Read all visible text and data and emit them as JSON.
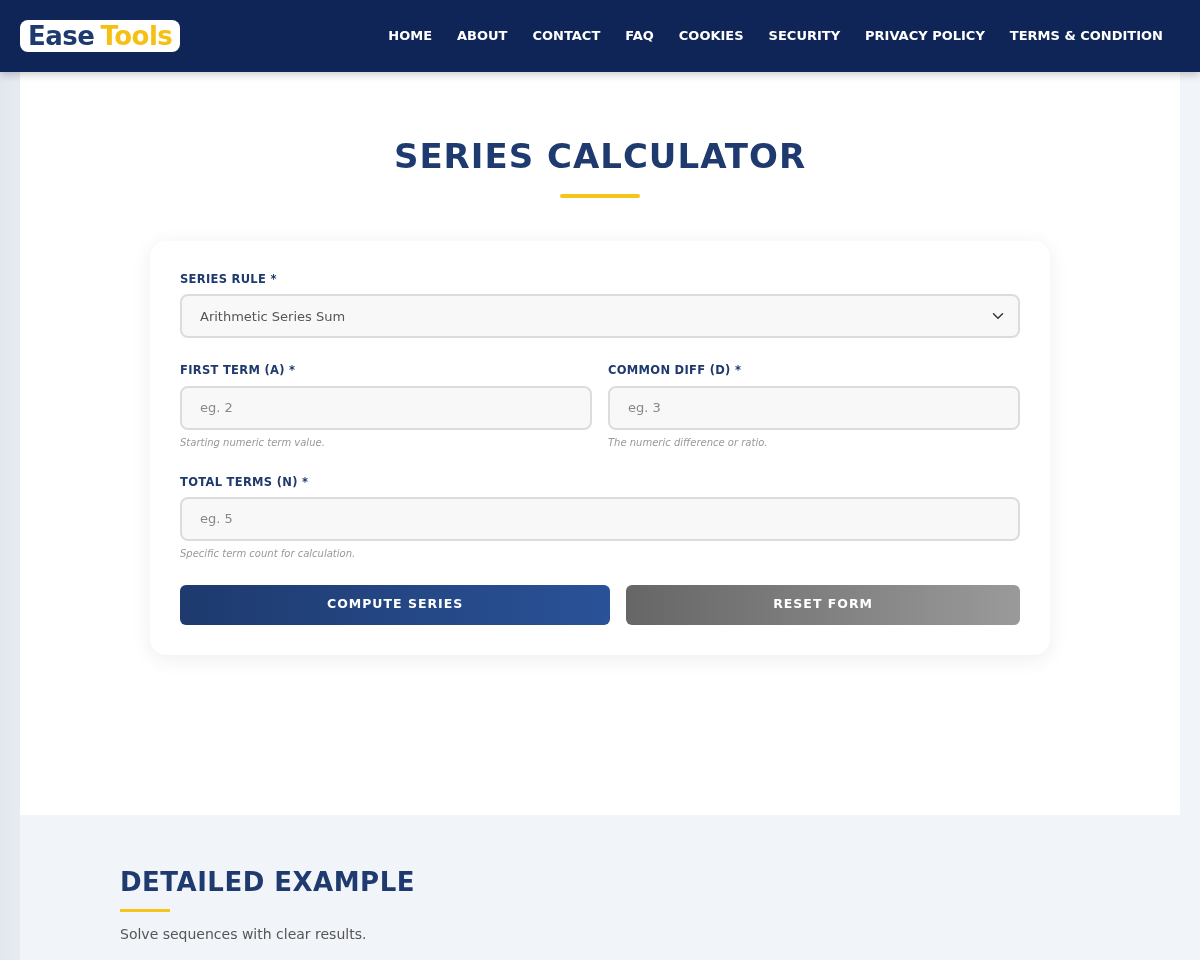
{
  "header": {
    "logo": {
      "part_1": "Ease",
      "part_2": "Tools"
    },
    "nav": [
      {
        "label": "HOME"
      },
      {
        "label": "ABOUT"
      },
      {
        "label": "CONTACT"
      },
      {
        "label": "FAQ"
      },
      {
        "label": "COOKIES"
      },
      {
        "label": "SECURITY"
      },
      {
        "label": "PRIVACY POLICY"
      },
      {
        "label": "TERMS & CONDITION"
      }
    ]
  },
  "calculator": {
    "title": "SERIES CALCULATOR",
    "rows": [
      [
        {
          "kind": "select",
          "label": "SERIES RULE *",
          "value": "Arithmetic Series Sum"
        }
      ],
      [
        {
          "kind": "input",
          "label": "FIRST TERM (A) *",
          "placeholder": "eg. 2",
          "hint": "Starting numeric term value."
        },
        {
          "kind": "input",
          "label": "COMMON DIFF (D) *",
          "placeholder": "eg. 3",
          "hint": "The numeric difference or ratio."
        }
      ],
      [
        {
          "kind": "input",
          "label": "TOTAL TERMS (N) *",
          "placeholder": "eg. 5",
          "hint": "Specific term count for calculation."
        }
      ]
    ],
    "buttons": [
      {
        "kind": "primary",
        "label": "COMPUTE SERIES"
      },
      {
        "kind": "secondary",
        "label": "RESET FORM"
      }
    ]
  },
  "example": {
    "title": "DETAILED EXAMPLE",
    "text": "Solve sequences with clear results."
  }
}
